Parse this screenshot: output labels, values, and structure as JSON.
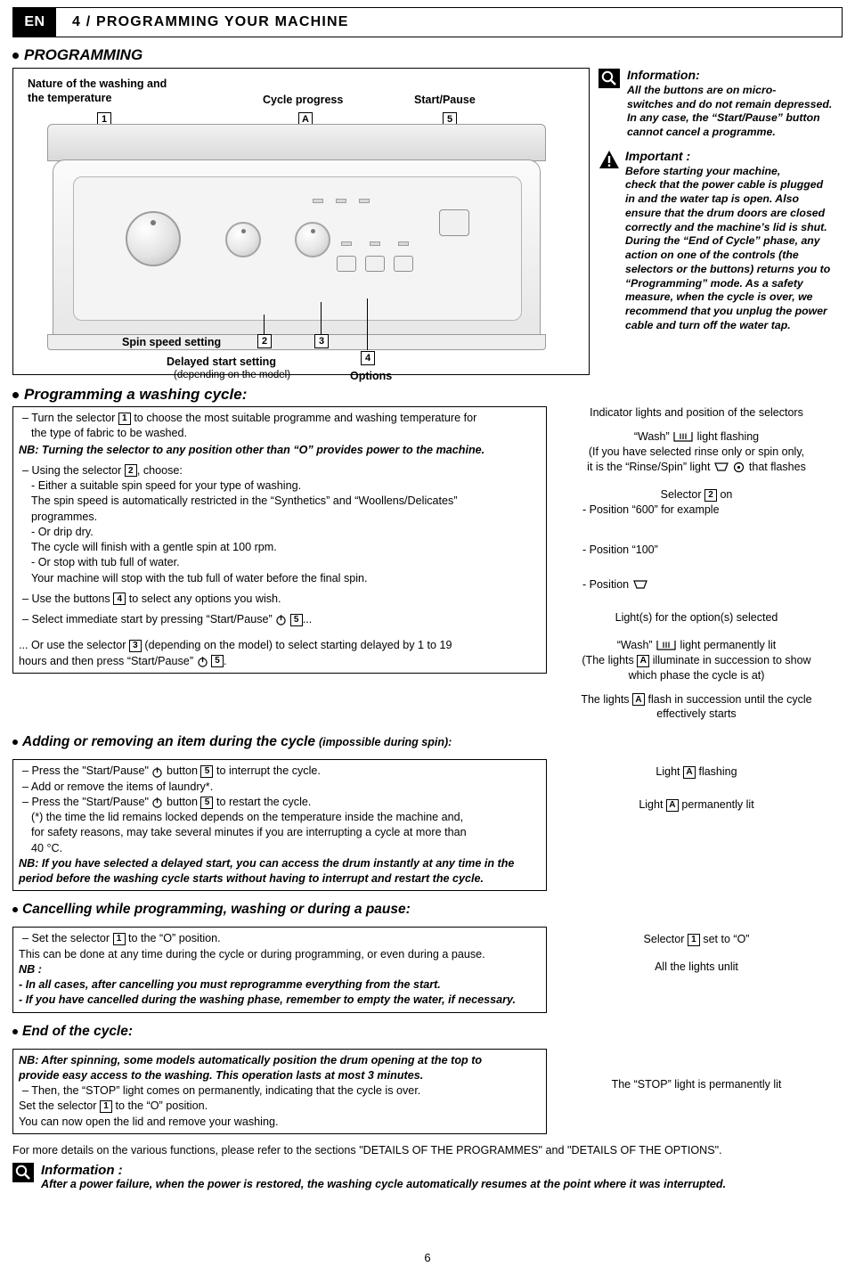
{
  "header": {
    "lang": "EN",
    "title": "4 / PROGRAMMING YOUR MACHINE"
  },
  "section1": {
    "title": "PROGRAMMING"
  },
  "panel": {
    "label_nature": "Nature of the washing and\nthe temperature",
    "label_nature_line1": "Nature of the washing and",
    "label_nature_line2": "the temperature",
    "label_cycle_progress": "Cycle progress",
    "label_startpause": "Start/Pause",
    "label_spin": "Spin speed setting",
    "label_delayed": "Delayed start setting",
    "label_delayed_sub": "(depending on the model)",
    "label_options": "Options",
    "n1": "1",
    "n2": "2",
    "n3": "3",
    "n4": "4",
    "n5": "5",
    "nA": "A"
  },
  "info_top": {
    "title": "Information:",
    "body": "All the buttons are on micro-switches and do not remain depressed. In any case, the “Start/Pause” button cannot cancel a programme.",
    "line1": "All the buttons are on micro-",
    "line2": "switches and do not remain depressed.",
    "line3": "In any case, the “Start/Pause” button",
    "line4": "cannot cancel a programme."
  },
  "important": {
    "title": "Important :",
    "lines": [
      "Before starting your machine,",
      "check that the power cable is plugged",
      "in and the water tap is open. Also",
      "ensure that the drum doors are closed",
      "correctly and the machine’s lid is shut.",
      "During the “End of Cycle” phase, any",
      "action on one of the controls (the",
      "selectors or the buttons) returns you to",
      "“Programming” mode. As a safety",
      "measure, when the cycle is over, we",
      "recommend that you unplug the power",
      "cable and turn off the water tap."
    ]
  },
  "section2": {
    "title": "Programming a washing cycle:",
    "right_head": "Indicator lights and position of the selectors",
    "l1a": "Turn the selector",
    "l1b": "to choose the most suitable programme and washing temperature for",
    "l1c": "the type of fabric to be washed.",
    "nb1": "NB: Turning the selector to any position other than “O” provides power to the machine.",
    "l2a": "Using the selector",
    "l2b": ", choose:",
    "l3": "- Either a suitable spin speed for your type of washing.",
    "l4": "The spin speed is automatically restricted in the “Synthetics” and “Woollens/Delicates”",
    "l5": "programmes.",
    "l6": "- Or drip dry.",
    "l7": "The cycle will finish with a gentle spin at 100 rpm.",
    "l8": "- Or stop with tub full of water.",
    "l9": "Your machine will stop with the tub full of water before the final spin.",
    "l10a": "Use the buttons",
    "l10b": "to select any options you wish.",
    "l11a": "Select immediate start by pressing “Start/Pause”",
    "l11b": "...",
    "l12a": "... Or use the selector",
    "l12b": "(depending on the model) to select starting delayed by 1 to 19",
    "l12c": "hours and then press “Start/Pause”",
    "l12d": ".",
    "r1a": "“Wash”",
    "r1b": "light flashing",
    "r2": "(If you have selected rinse only or spin only,",
    "r3a": "it is the “Rinse/Spin” light",
    "r3b": "that flashes",
    "r4a": "Selector",
    "r4b": "on",
    "r5": "- Position “600” for example",
    "r6": "- Position “100”",
    "r7": "- Position",
    "r8": "Light(s) for the option(s) selected",
    "r9a": "“Wash”",
    "r9b": "light permanently lit",
    "r10a": "(The  lights",
    "r10b": "illuminate in succession to show",
    "r11": "which phase the cycle is at)",
    "r12a": "The lights",
    "r12b": "flash in succession until the cycle",
    "r13": "effectively starts"
  },
  "section3": {
    "title": "Adding or removing an item during the cycle",
    "title_tail": "(impossible during spin):",
    "a1a": "Press the \"Start/Pause\"",
    "a1b": "button",
    "a1c": "to interrupt the cycle.",
    "a2": "Add or remove the items of laundry*.",
    "a3a": "Press the \"Start/Pause\"",
    "a3b": "button",
    "a3c": "to restart the cycle.",
    "a4": "(*) the time the lid remains locked depends on the temperature inside the machine and,",
    "a5": "for safety reasons, may take several minutes if you are interrupting a cycle at more than",
    "a6": "40  °C.",
    "a7": "NB: If you have selected a delayed start, you can access the drum instantly at any time in the",
    "a8": "period before the washing cycle starts without having to interrupt and restart the cycle.",
    "r1a": "Light",
    "r1b": "flashing",
    "r2a": "Light",
    "r2b": "permanently lit"
  },
  "section4": {
    "title": "Cancelling while programming, washing or during a pause:",
    "c1a": "Set the selector",
    "c1b": "to the “O” position.",
    "c2": "This can be done at any time during the cycle or during programming, or even during a pause.",
    "c3": "NB :",
    "c4": "- In all cases, after cancelling you must reprogramme everything from the start.",
    "c5": "- If you have cancelled during the washing phase, remember to empty the water, if necessary.",
    "r1a": "Selector",
    "r1b": "set to “O”",
    "r2": "All the lights unlit"
  },
  "section5": {
    "title": "End of the cycle:",
    "e1": "NB: After spinning, some models automatically position the drum opening at the top to",
    "e2": "provide easy access to the washing. This operation lasts at most 3 minutes.",
    "e3": "Then, the “STOP” light comes on permanently, indicating that the cycle is over.",
    "e4a": "Set the selector",
    "e4b": "to the “O” position.",
    "e5": "You can now open the lid and remove your washing.",
    "r1": "The “STOP” light is permanently lit"
  },
  "footer": {
    "details": "For more details on the various functions, please refer to the sections \"DETAILS OF THE PROGRAMMES\" and \"DETAILS OF THE OPTIONS\".",
    "info_title": "Information :",
    "info_body": "After a power failure, when the power is restored, the washing cycle automatically resumes at the point where it was interrupted.",
    "page": "6"
  },
  "icons": {
    "info": "magnifier-info-icon",
    "warning": "warning-triangle-icon",
    "wash": "wash-symbol-icon",
    "spin": "spin-symbol-icon",
    "power": "power-symbol-icon",
    "drip": "drip-dry-icon"
  }
}
